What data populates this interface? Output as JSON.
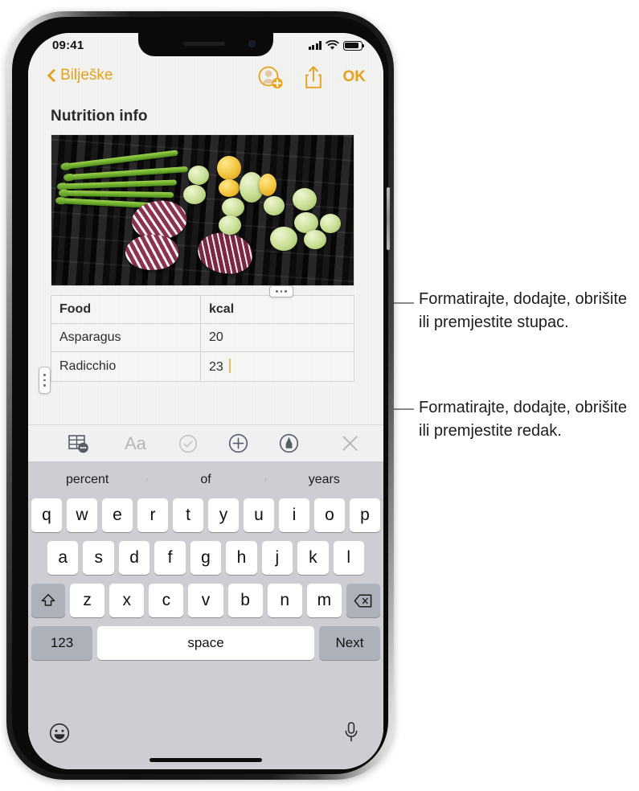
{
  "status_bar": {
    "time": "09:41",
    "signal_icon": "cellular-signal-icon",
    "wifi_icon": "wifi-icon",
    "battery_icon": "battery-icon"
  },
  "nav_bar": {
    "back_label": "Bilješke",
    "back_chevron_icon": "chevron-left-icon",
    "person_add_icon": "person-add-icon",
    "share_icon": "share-icon",
    "done_label": "OK",
    "accent_color": "#E4A11B"
  },
  "note": {
    "title": "Nutrition info",
    "image_alt": "grilled-vegetables-photo"
  },
  "table": {
    "column_handle_icon": "column-handle-dots-icon",
    "row_handle_icon": "row-handle-dots-icon",
    "headers": [
      "Food",
      "kcal"
    ],
    "rows": [
      [
        "Asparagus",
        "20"
      ],
      [
        "Radicchio",
        "23"
      ]
    ],
    "caret_color": "#E4C06B"
  },
  "format_toolbar": {
    "items": [
      {
        "name": "table-format-icon",
        "label": "",
        "state": "active"
      },
      {
        "name": "text-format-icon",
        "label": "Aa",
        "state": "disabled"
      },
      {
        "name": "checklist-icon",
        "label": "",
        "state": "disabled"
      },
      {
        "name": "add-attachment-icon",
        "label": "",
        "state": "active"
      },
      {
        "name": "markup-pen-icon",
        "label": "",
        "state": "active"
      },
      {
        "name": "close-keyboard-icon",
        "label": "",
        "state": "dim"
      }
    ]
  },
  "keyboard": {
    "predictions": [
      "percent",
      "of",
      "years"
    ],
    "row1": [
      "q",
      "w",
      "e",
      "r",
      "t",
      "y",
      "u",
      "i",
      "o",
      "p"
    ],
    "row2": [
      "a",
      "s",
      "d",
      "f",
      "g",
      "h",
      "j",
      "k",
      "l"
    ],
    "row3": [
      "z",
      "x",
      "c",
      "v",
      "b",
      "n",
      "m"
    ],
    "shift_icon": "shift-arrow-icon",
    "backspace_icon": "backspace-icon",
    "numbers_label": "123",
    "space_label": "space",
    "return_label": "Next",
    "emoji_icon": "emoji-smiley-icon",
    "dictation_icon": "microphone-icon",
    "home_indicator": "home-indicator"
  },
  "callouts": [
    {
      "text": "Formatirajte, dodajte, obrišite ili premjestite stupac."
    },
    {
      "text": "Formatirajte, dodajte, obrišite ili premjestite redak."
    }
  ]
}
